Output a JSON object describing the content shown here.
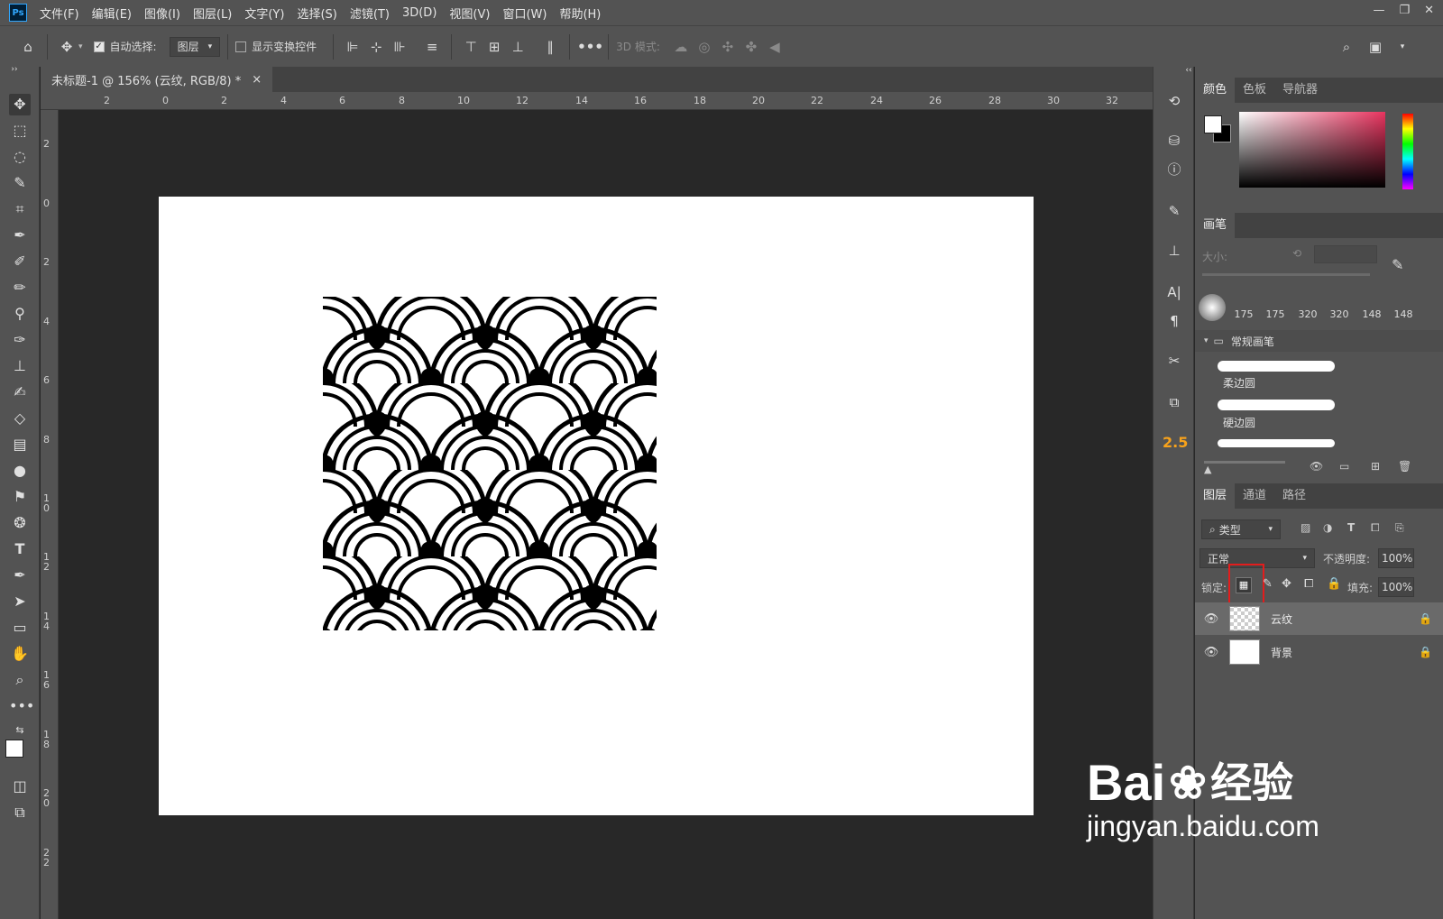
{
  "app": {
    "logo": "Ps"
  },
  "menu": [
    "文件(F)",
    "编辑(E)",
    "图像(I)",
    "图层(L)",
    "文字(Y)",
    "选择(S)",
    "滤镜(T)",
    "3D(D)",
    "视图(V)",
    "窗口(W)",
    "帮助(H)"
  ],
  "options": {
    "auto_select_label": "自动选择:",
    "auto_select_value": "图层",
    "show_transform_label": "显示变换控件",
    "mode_3d_label": "3D 模式:"
  },
  "document_tab": {
    "title": "未标题-1 @ 156% (云纹, RGB/8) *",
    "close": "×"
  },
  "ruler_h": [
    "2",
    "0",
    "2",
    "4",
    "6",
    "8",
    "10",
    "12",
    "14",
    "16",
    "18",
    "20",
    "22",
    "24",
    "26",
    "28",
    "30",
    "32"
  ],
  "ruler_v": [
    "2",
    "0",
    "2",
    "4",
    "6",
    "8",
    "1\n0",
    "1\n2",
    "1\n4",
    "1\n6",
    "1\n8",
    "2\n0",
    "2\n2"
  ],
  "color_panel": {
    "tabs": [
      "颜色",
      "色板",
      "导航器"
    ]
  },
  "brush_panel": {
    "title": "画笔",
    "size_label": "大小:",
    "sizes": [
      "175",
      "175",
      "320",
      "320",
      "148",
      "148"
    ],
    "group": "常规画笔",
    "presets": [
      "柔边圆",
      "硬边圆"
    ]
  },
  "version_badge": "2.5",
  "layers_panel": {
    "tabs": [
      "图层",
      "通道",
      "路径"
    ],
    "filter": "类型",
    "blend_mode": "正常",
    "opacity_label": "不透明度:",
    "opacity": "100%",
    "lock_label": "锁定:",
    "fill_label": "填充:",
    "fill": "100%",
    "layers": [
      {
        "name": "云纹"
      },
      {
        "name": "背景"
      }
    ]
  },
  "watermark": {
    "brand": "Bai",
    "brand2": "经验",
    "url": "jingyan.baidu.com"
  }
}
